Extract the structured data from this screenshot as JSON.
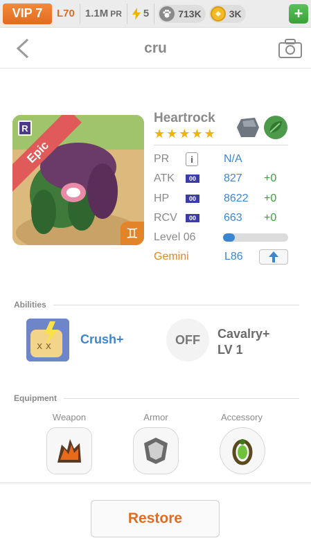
{
  "topbar": {
    "vip": "VIP 7",
    "level": "L70",
    "power": "1.1M",
    "power_unit": "PR",
    "energy": "5",
    "paws": "713K",
    "coins": "3K",
    "plus": "+"
  },
  "header": {
    "title": "cru"
  },
  "hero": {
    "name": "Heartrock",
    "rarity_badge": "R",
    "rarity": "Epic",
    "stars": 5,
    "star_glyphs": [
      "★",
      "★",
      "★",
      "★",
      "★"
    ],
    "zodiac_glyph": "♊",
    "elements": [
      "rock-icon",
      "leaf-icon"
    ]
  },
  "stats": {
    "pr_label": "PR",
    "pr_info": "i",
    "pr_value": "N/A",
    "atk_label": "ATK",
    "atk_badge": "00",
    "atk_value": "827",
    "atk_bonus": "+0",
    "hp_label": "HP",
    "hp_badge": "00",
    "hp_value": "8622",
    "hp_bonus": "+0",
    "rcv_label": "RCV",
    "rcv_badge": "00",
    "rcv_value": "663",
    "rcv_bonus": "+0",
    "level_label": "Level 06",
    "level_progress": 0.18,
    "sign_label": "Gemini",
    "sign_level": "L86"
  },
  "abilities": {
    "section_label": "Abilities",
    "ability1_name": "Crush+",
    "ability2_state": "OFF",
    "ability2_name_line1": "Cavalry+",
    "ability2_name_line2": "LV 1"
  },
  "equipment": {
    "section_label": "Equipment",
    "weapon_label": "Weapon",
    "armor_label": "Armor",
    "accessory_label": "Accessory"
  },
  "footer": {
    "restore_label": "Restore"
  },
  "colors": {
    "accent": "#e26b1f",
    "stat_blue": "#3c86d0",
    "bonus_green": "#3aa13a",
    "epic_red": "#e05a5a"
  }
}
